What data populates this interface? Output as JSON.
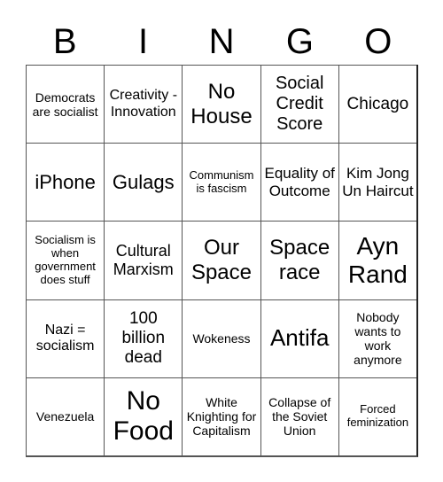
{
  "title_letters": [
    "B",
    "I",
    "N",
    "G",
    "O"
  ],
  "cells": [
    [
      "Democrats are socialist",
      "Creativity - Innovation",
      "No House",
      "Social Credit Score",
      "Chicago"
    ],
    [
      "iPhone",
      "Gulags",
      "Communism is fascism",
      "Equality of Outcome",
      "Kim Jong Un Haircut"
    ],
    [
      "Socialism is when government does stuff",
      "Cultural Marxism",
      "Our Space",
      "Space race",
      "Ayn Rand"
    ],
    [
      "Nazi = socialism",
      "100 billion dead",
      "Wokeness",
      "Antifa",
      "Nobody wants to work anymore"
    ],
    [
      "Venezuela",
      "No Food",
      "White Knighting for Capitalism",
      "Collapse of the Soviet Union",
      "Forced feminization"
    ]
  ]
}
